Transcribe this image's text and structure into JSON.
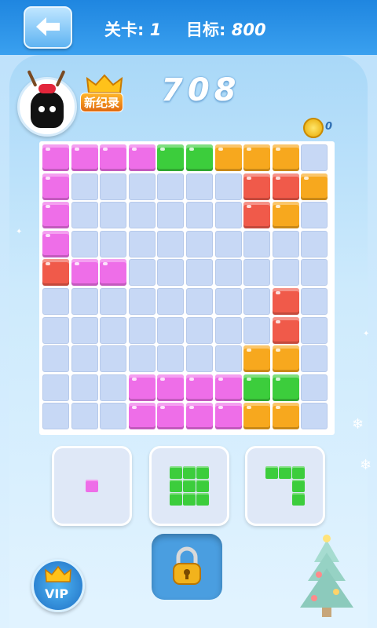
{
  "header": {
    "back_label": "←",
    "level_label": "关卡:",
    "level_value": "1",
    "target_label": "目标:",
    "target_value": "800"
  },
  "player": {
    "record_badge": "新纪录",
    "score": "708",
    "coins": "0"
  },
  "colors": {
    "P": "#ee6ee8",
    "G": "#3ccd3c",
    "O": "#f7a81e",
    "R": "#f05a4a"
  },
  "board": {
    "rows": [
      "PPPPGGOOO.",
      "P......RRO",
      "P......RO.",
      "P.........",
      "RPP.......",
      "........R.",
      "........R.",
      ".......OO.",
      "...PPPPGG.",
      "...PPPPOO."
    ]
  },
  "pieces": [
    {
      "name": "piece-single",
      "color": "P",
      "cells": [
        [
          0,
          0
        ]
      ]
    },
    {
      "name": "piece-square3",
      "color": "G",
      "cells": [
        [
          0,
          0
        ],
        [
          0,
          1
        ],
        [
          0,
          2
        ],
        [
          1,
          0
        ],
        [
          1,
          1
        ],
        [
          1,
          2
        ],
        [
          2,
          0
        ],
        [
          2,
          1
        ],
        [
          2,
          2
        ]
      ]
    },
    {
      "name": "piece-hook",
      "color": "G",
      "cells": [
        [
          0,
          0
        ],
        [
          0,
          1
        ],
        [
          0,
          2
        ],
        [
          1,
          2
        ],
        [
          2,
          2
        ]
      ]
    }
  ],
  "vip_label": "VIP"
}
